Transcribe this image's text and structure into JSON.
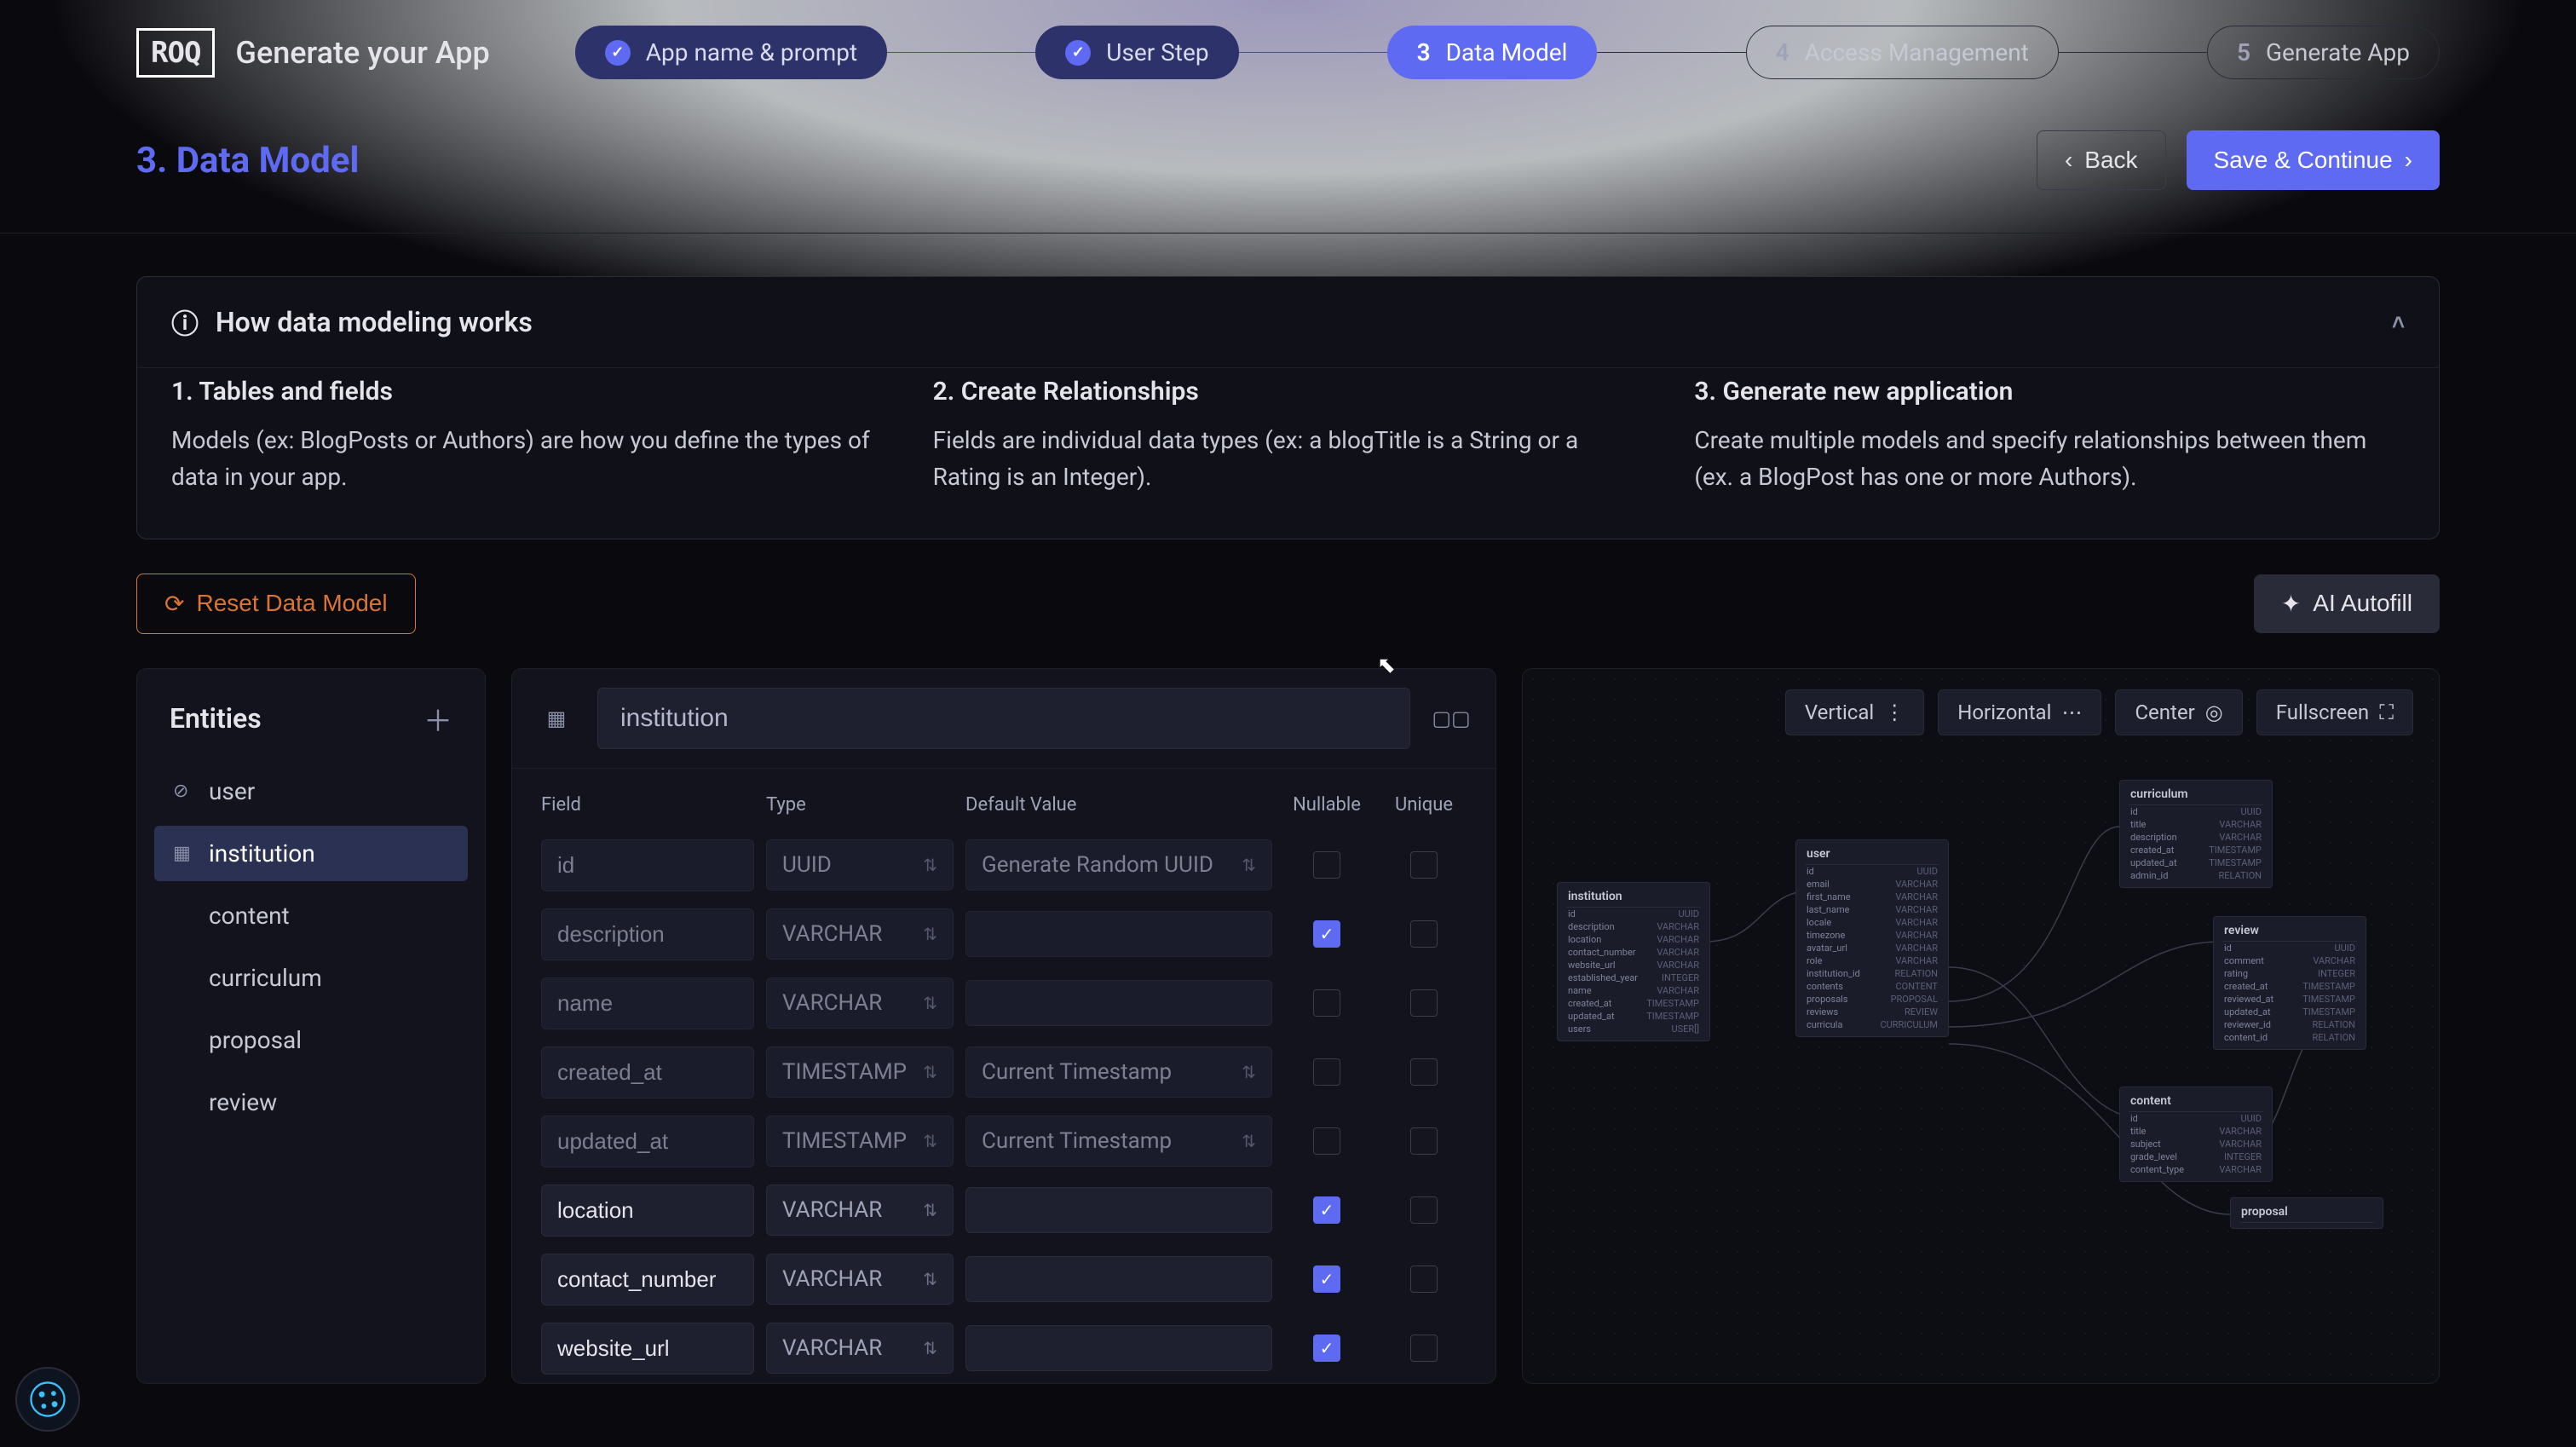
{
  "brand": {
    "logo": "ROQ",
    "tagline": "Generate your App"
  },
  "stepper": {
    "steps": [
      {
        "num": "",
        "label": "App name & prompt",
        "state": "done"
      },
      {
        "num": "",
        "label": "User Step",
        "state": "done"
      },
      {
        "num": "3",
        "label": "Data Model",
        "state": "current"
      },
      {
        "num": "4",
        "label": "Access Management",
        "state": "future"
      },
      {
        "num": "5",
        "label": "Generate App",
        "state": "future"
      }
    ]
  },
  "page": {
    "title": "3. Data Model"
  },
  "actions": {
    "back": "Back",
    "save_continue": "Save & Continue",
    "reset": "Reset Data Model",
    "ai_autofill": "AI Autofill"
  },
  "explain": {
    "header": "How data modeling works",
    "cols": [
      {
        "title": "1. Tables and fields",
        "body": "Models (ex: BlogPosts or Authors) are how you define the types of data in your app."
      },
      {
        "title": "2. Create Relationships",
        "body": "Fields are individual data types (ex: a blogTitle is a String or a Rating is an Integer)."
      },
      {
        "title": "3. Generate new application",
        "body": "Create multiple models and specify relationships between them (ex. a BlogPost has one or more Authors)."
      }
    ]
  },
  "sidebar": {
    "title": "Entities",
    "items": [
      {
        "label": "user",
        "icon": "user"
      },
      {
        "label": "institution",
        "icon": "grid",
        "active": true
      },
      {
        "label": "content",
        "icon": ""
      },
      {
        "label": "curriculum",
        "icon": ""
      },
      {
        "label": "proposal",
        "icon": ""
      },
      {
        "label": "review",
        "icon": ""
      }
    ]
  },
  "editor": {
    "name": "institution",
    "headers": {
      "field": "Field",
      "type": "Type",
      "default": "Default Value",
      "nullable": "Nullable",
      "unique": "Unique"
    },
    "rows": [
      {
        "field": "id",
        "type": "UUID",
        "default": "Generate Random UUID",
        "nullable": false,
        "unique": false,
        "locked": true
      },
      {
        "field": "description",
        "type": "VARCHAR",
        "default": "",
        "nullable": true,
        "unique": false,
        "locked": true
      },
      {
        "field": "name",
        "type": "VARCHAR",
        "default": "",
        "nullable": false,
        "unique": false,
        "locked": true
      },
      {
        "field": "created_at",
        "type": "TIMESTAMP",
        "default": "Current Timestamp",
        "nullable": false,
        "unique": false,
        "locked": true
      },
      {
        "field": "updated_at",
        "type": "TIMESTAMP",
        "default": "Current Timestamp",
        "nullable": false,
        "unique": false,
        "locked": true
      },
      {
        "field": "location",
        "type": "VARCHAR",
        "default": "",
        "nullable": true,
        "unique": false,
        "locked": false
      },
      {
        "field": "contact_number",
        "type": "VARCHAR",
        "default": "",
        "nullable": true,
        "unique": false,
        "locked": false
      },
      {
        "field": "website_url",
        "type": "VARCHAR",
        "default": "",
        "nullable": true,
        "unique": false,
        "locked": false
      }
    ]
  },
  "diagram": {
    "toolbar": {
      "vertical": "Vertical",
      "horizontal": "Horizontal",
      "center": "Center",
      "fullscreen": "Fullscreen"
    },
    "boxes": {
      "institution": {
        "title": "institution",
        "rows": [
          [
            "id",
            "UUID"
          ],
          [
            "description",
            "VARCHAR"
          ],
          [
            "location",
            "VARCHAR"
          ],
          [
            "contact_number",
            "VARCHAR"
          ],
          [
            "website_url",
            "VARCHAR"
          ],
          [
            "established_year",
            "INTEGER"
          ],
          [
            "name",
            "VARCHAR"
          ],
          [
            "created_at",
            "TIMESTAMP"
          ],
          [
            "updated_at",
            "TIMESTAMP"
          ],
          [
            "users",
            "USER[]"
          ]
        ]
      },
      "user": {
        "title": "user",
        "rows": [
          [
            "id",
            "UUID"
          ],
          [
            "email",
            "VARCHAR"
          ],
          [
            "first_name",
            "VARCHAR"
          ],
          [
            "last_name",
            "VARCHAR"
          ],
          [
            "locale",
            "VARCHAR"
          ],
          [
            "timezone",
            "VARCHAR"
          ],
          [
            "avatar_url",
            "VARCHAR"
          ],
          [
            "role",
            "VARCHAR"
          ],
          [
            "institution_id",
            "RELATION"
          ],
          [
            "contents",
            "CONTENT"
          ],
          [
            "proposals",
            "PROPOSAL"
          ],
          [
            "reviews",
            "REVIEW"
          ],
          [
            "curricula",
            "CURRICULUM"
          ]
        ]
      },
      "curriculum": {
        "title": "curriculum",
        "rows": [
          [
            "id",
            "UUID"
          ],
          [
            "title",
            "VARCHAR"
          ],
          [
            "description",
            "VARCHAR"
          ],
          [
            "created_at",
            "TIMESTAMP"
          ],
          [
            "updated_at",
            "TIMESTAMP"
          ],
          [
            "admin_id",
            "RELATION"
          ]
        ]
      },
      "review": {
        "title": "review",
        "rows": [
          [
            "id",
            "UUID"
          ],
          [
            "comment",
            "VARCHAR"
          ],
          [
            "rating",
            "INTEGER"
          ],
          [
            "created_at",
            "TIMESTAMP"
          ],
          [
            "reviewed_at",
            "TIMESTAMP"
          ],
          [
            "updated_at",
            "TIMESTAMP"
          ],
          [
            "reviewer_id",
            "RELATION"
          ],
          [
            "content_id",
            "RELATION"
          ]
        ]
      },
      "content": {
        "title": "content",
        "rows": [
          [
            "id",
            "UUID"
          ],
          [
            "title",
            "VARCHAR"
          ],
          [
            "subject",
            "VARCHAR"
          ],
          [
            "grade_level",
            "INTEGER"
          ],
          [
            "content_type",
            "VARCHAR"
          ]
        ]
      },
      "proposal": {
        "title": "proposal",
        "rows": []
      }
    }
  }
}
